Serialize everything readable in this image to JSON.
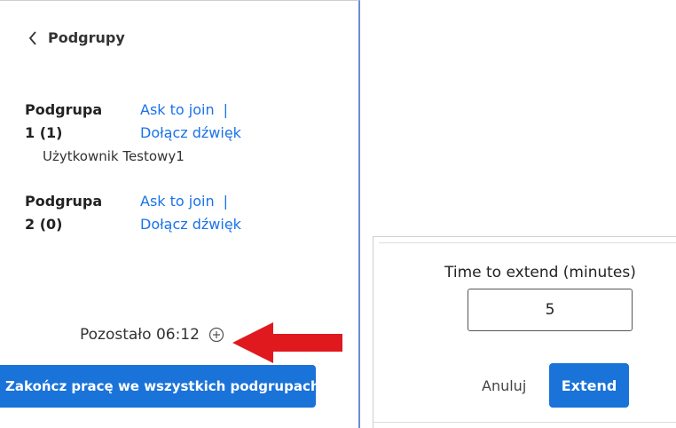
{
  "header": {
    "back_label": "Podgrupy"
  },
  "groups": [
    {
      "title_line1": "Podgrupa",
      "title_line2": "1 (1)",
      "join_label": "Ask to join",
      "separator": "|",
      "audio_label": "Dołącz dźwięk",
      "members": [
        "Użytkownik Testowy1"
      ]
    },
    {
      "title_line1": "Podgrupa",
      "title_line2": "2 (0)",
      "join_label": "Ask to join",
      "separator": "|",
      "audio_label": "Dołącz dźwięk",
      "members": []
    }
  ],
  "timer": {
    "remaining_text": "Pozostało 06:12"
  },
  "end_all_label": "Zakończ pracę we wszystkich podgrupach",
  "dialog": {
    "title": "Time to extend (minutes)",
    "minutes_value": "5",
    "cancel_label": "Anuluj",
    "extend_label": "Extend"
  },
  "colors": {
    "accent": "#1a73d9",
    "link": "#1a73e8",
    "annotation_arrow": "#e0191f"
  },
  "icons": {
    "back": "chevron-left-icon",
    "extend_time": "plus-circle-icon",
    "annotation": "red-arrow"
  }
}
